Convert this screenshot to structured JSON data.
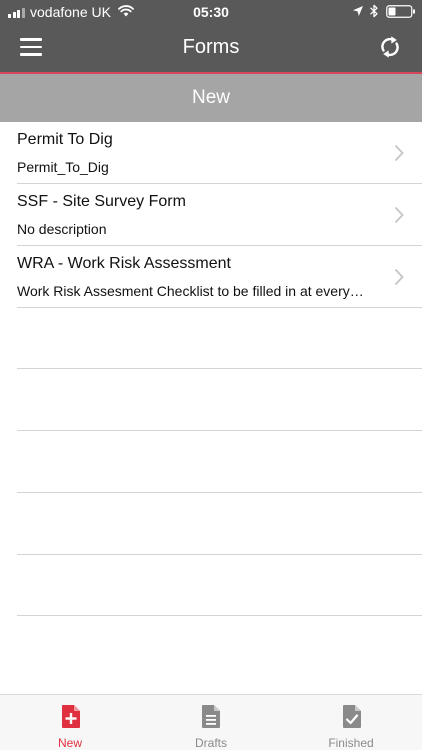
{
  "status_bar": {
    "carrier": "vodafone UK",
    "time": "05:30"
  },
  "header": {
    "title": "Forms",
    "menu_icon": "hamburger-menu-icon",
    "sync_icon": "sync-icon",
    "accent_color": "#d8465a"
  },
  "section": {
    "title": "New"
  },
  "forms": [
    {
      "title": "Permit To Dig",
      "description": "Permit_To_Dig"
    },
    {
      "title": "SSF - Site Survey Form",
      "description": "No description"
    },
    {
      "title": "WRA - Work Risk Assessment",
      "description": "Work Risk Assesment Checklist to be filled in at every site"
    }
  ],
  "tabs": [
    {
      "label": "New",
      "icon": "new-document-icon",
      "active": true
    },
    {
      "label": "Drafts",
      "icon": "draft-document-icon",
      "active": false
    },
    {
      "label": "Finished",
      "icon": "finished-document-icon",
      "active": false
    }
  ],
  "colors": {
    "header": "#595959",
    "section_bar": "#a5a5a5",
    "active_tab": "#e0303f",
    "inactive_tab": "#8a8a8a"
  }
}
